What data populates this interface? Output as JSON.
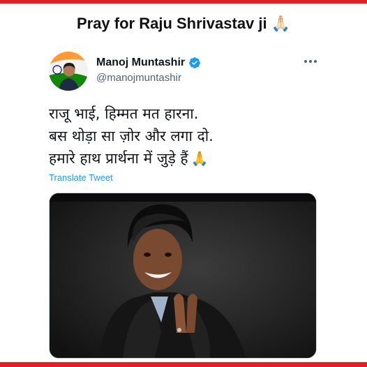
{
  "page": {
    "headline": "Pray for Raju Shrivastav ji",
    "headline_emoji": "🙏🏻",
    "frame_color": "#e31e24"
  },
  "tweet": {
    "author_name": "Manoj Muntashir",
    "author_handle": "@manojmuntashir",
    "verified": true,
    "more_label": "···",
    "lines": [
      "राजू भाई, हिम्मत मत हारना.",
      "बस थोड़ा सा ज़ोर और लगा दो.",
      "हमारे हाथ प्रार्थना में जुड़े हैं"
    ],
    "line_emoji": "🙏",
    "translate_label": "Translate Tweet",
    "media_alt_icon": "photo-of-man-with-folded-hands"
  },
  "colors": {
    "accent": "#1d9bf0",
    "handle": "#536471",
    "text": "#0f1419"
  }
}
